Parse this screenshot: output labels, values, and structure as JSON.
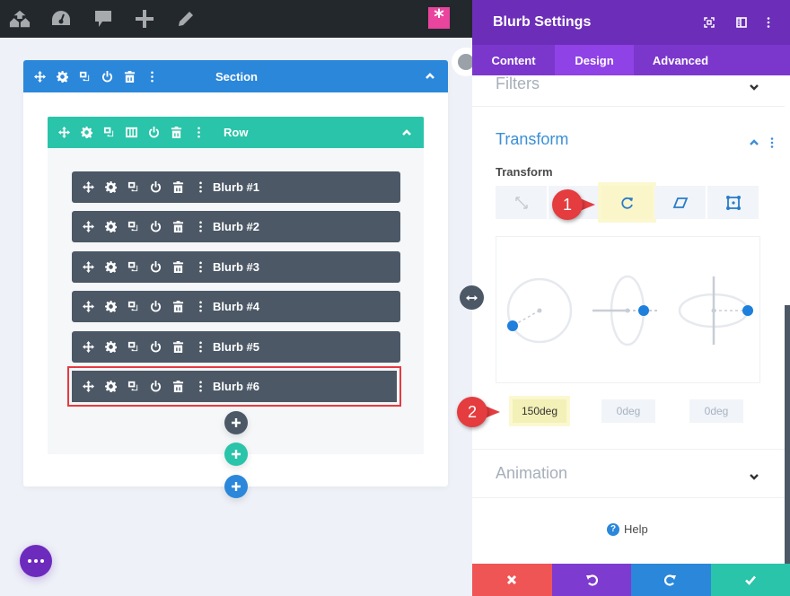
{
  "admin_bar": {
    "icons": [
      "sites-icon",
      "dashboard-icon",
      "comments-icon",
      "add-new-icon",
      "edit-icon"
    ],
    "builder_badge": "*"
  },
  "section": {
    "label": "Section",
    "color": "#2b87da",
    "row": {
      "label": "Row",
      "color": "#29c4a9",
      "modules": [
        {
          "label": "Blurb #1",
          "selected": false
        },
        {
          "label": "Blurb #2",
          "selected": false
        },
        {
          "label": "Blurb #3",
          "selected": false
        },
        {
          "label": "Blurb #4",
          "selected": false
        },
        {
          "label": "Blurb #5",
          "selected": false
        },
        {
          "label": "Blurb #6",
          "selected": true
        }
      ]
    }
  },
  "add_buttons": {
    "module": "+",
    "row": "+",
    "section": "+"
  },
  "more_button": "...",
  "panel": {
    "title": "Blurb Settings",
    "header_icons": [
      "fullscreen-icon",
      "sidebar-snap-icon",
      "more-options-icon"
    ],
    "tabs": [
      {
        "label": "Content",
        "active": false
      },
      {
        "label": "Design",
        "active": true
      },
      {
        "label": "Advanced",
        "active": false
      }
    ],
    "toggles": {
      "filters": "Filters",
      "transform": "Transform",
      "animation": "Animation"
    },
    "transform": {
      "field_label": "Transform",
      "options": [
        {
          "name": "scale",
          "icon": "scale-icon",
          "active": false
        },
        {
          "name": "translate",
          "icon": "translate-icon",
          "active": false
        },
        {
          "name": "rotate",
          "icon": "rotate-icon",
          "active": true
        },
        {
          "name": "skew",
          "icon": "skew-icon",
          "active": false
        },
        {
          "name": "origin",
          "icon": "origin-icon",
          "active": false
        }
      ],
      "rotate_values": [
        {
          "axis": "z",
          "value": "150deg",
          "placeholder": "0deg"
        },
        {
          "axis": "x",
          "value": "",
          "placeholder": "0deg"
        },
        {
          "axis": "y",
          "value": "",
          "placeholder": "0deg"
        }
      ]
    },
    "help_label": "Help",
    "footer": [
      {
        "name": "discard",
        "icon": "close-icon",
        "color": "#ef5555"
      },
      {
        "name": "undo",
        "icon": "undo-icon",
        "color": "#7e3bd0"
      },
      {
        "name": "redo",
        "icon": "redo-icon",
        "color": "#2b87da"
      },
      {
        "name": "save",
        "icon": "check-icon",
        "color": "#29c4a9"
      }
    ]
  },
  "callouts": [
    {
      "number": "1",
      "target": "rotate option"
    },
    {
      "number": "2",
      "target": "rotate z input"
    }
  ]
}
